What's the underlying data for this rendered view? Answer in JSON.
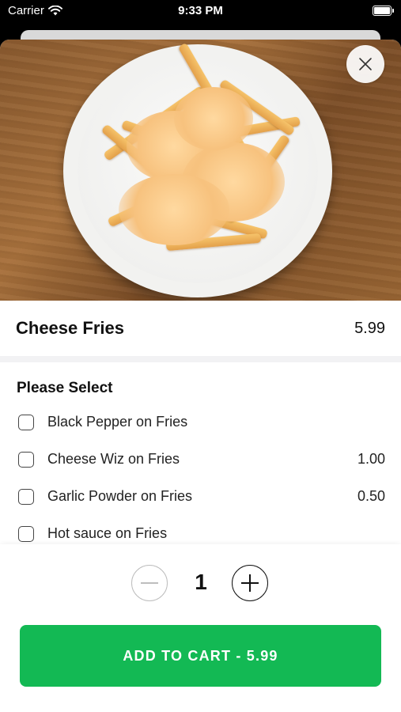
{
  "status_bar": {
    "carrier": "Carrier",
    "time": "9:33 PM"
  },
  "item": {
    "name": "Cheese Fries",
    "price": "5.99"
  },
  "options": {
    "heading": "Please Select",
    "items": [
      {
        "label": "Black Pepper on Fries",
        "price": ""
      },
      {
        "label": "Cheese Wiz on Fries",
        "price": "1.00"
      },
      {
        "label": "Garlic Powder on Fries",
        "price": "0.50"
      },
      {
        "label": "Hot sauce on Fries",
        "price": ""
      }
    ]
  },
  "quantity": {
    "value": "1"
  },
  "cart_button": {
    "label": "ADD TO CART  -  5.99"
  },
  "colors": {
    "accent": "#13b954"
  },
  "icons": [
    "wifi-icon",
    "battery-icon",
    "close-icon",
    "minus-icon",
    "plus-icon"
  ]
}
